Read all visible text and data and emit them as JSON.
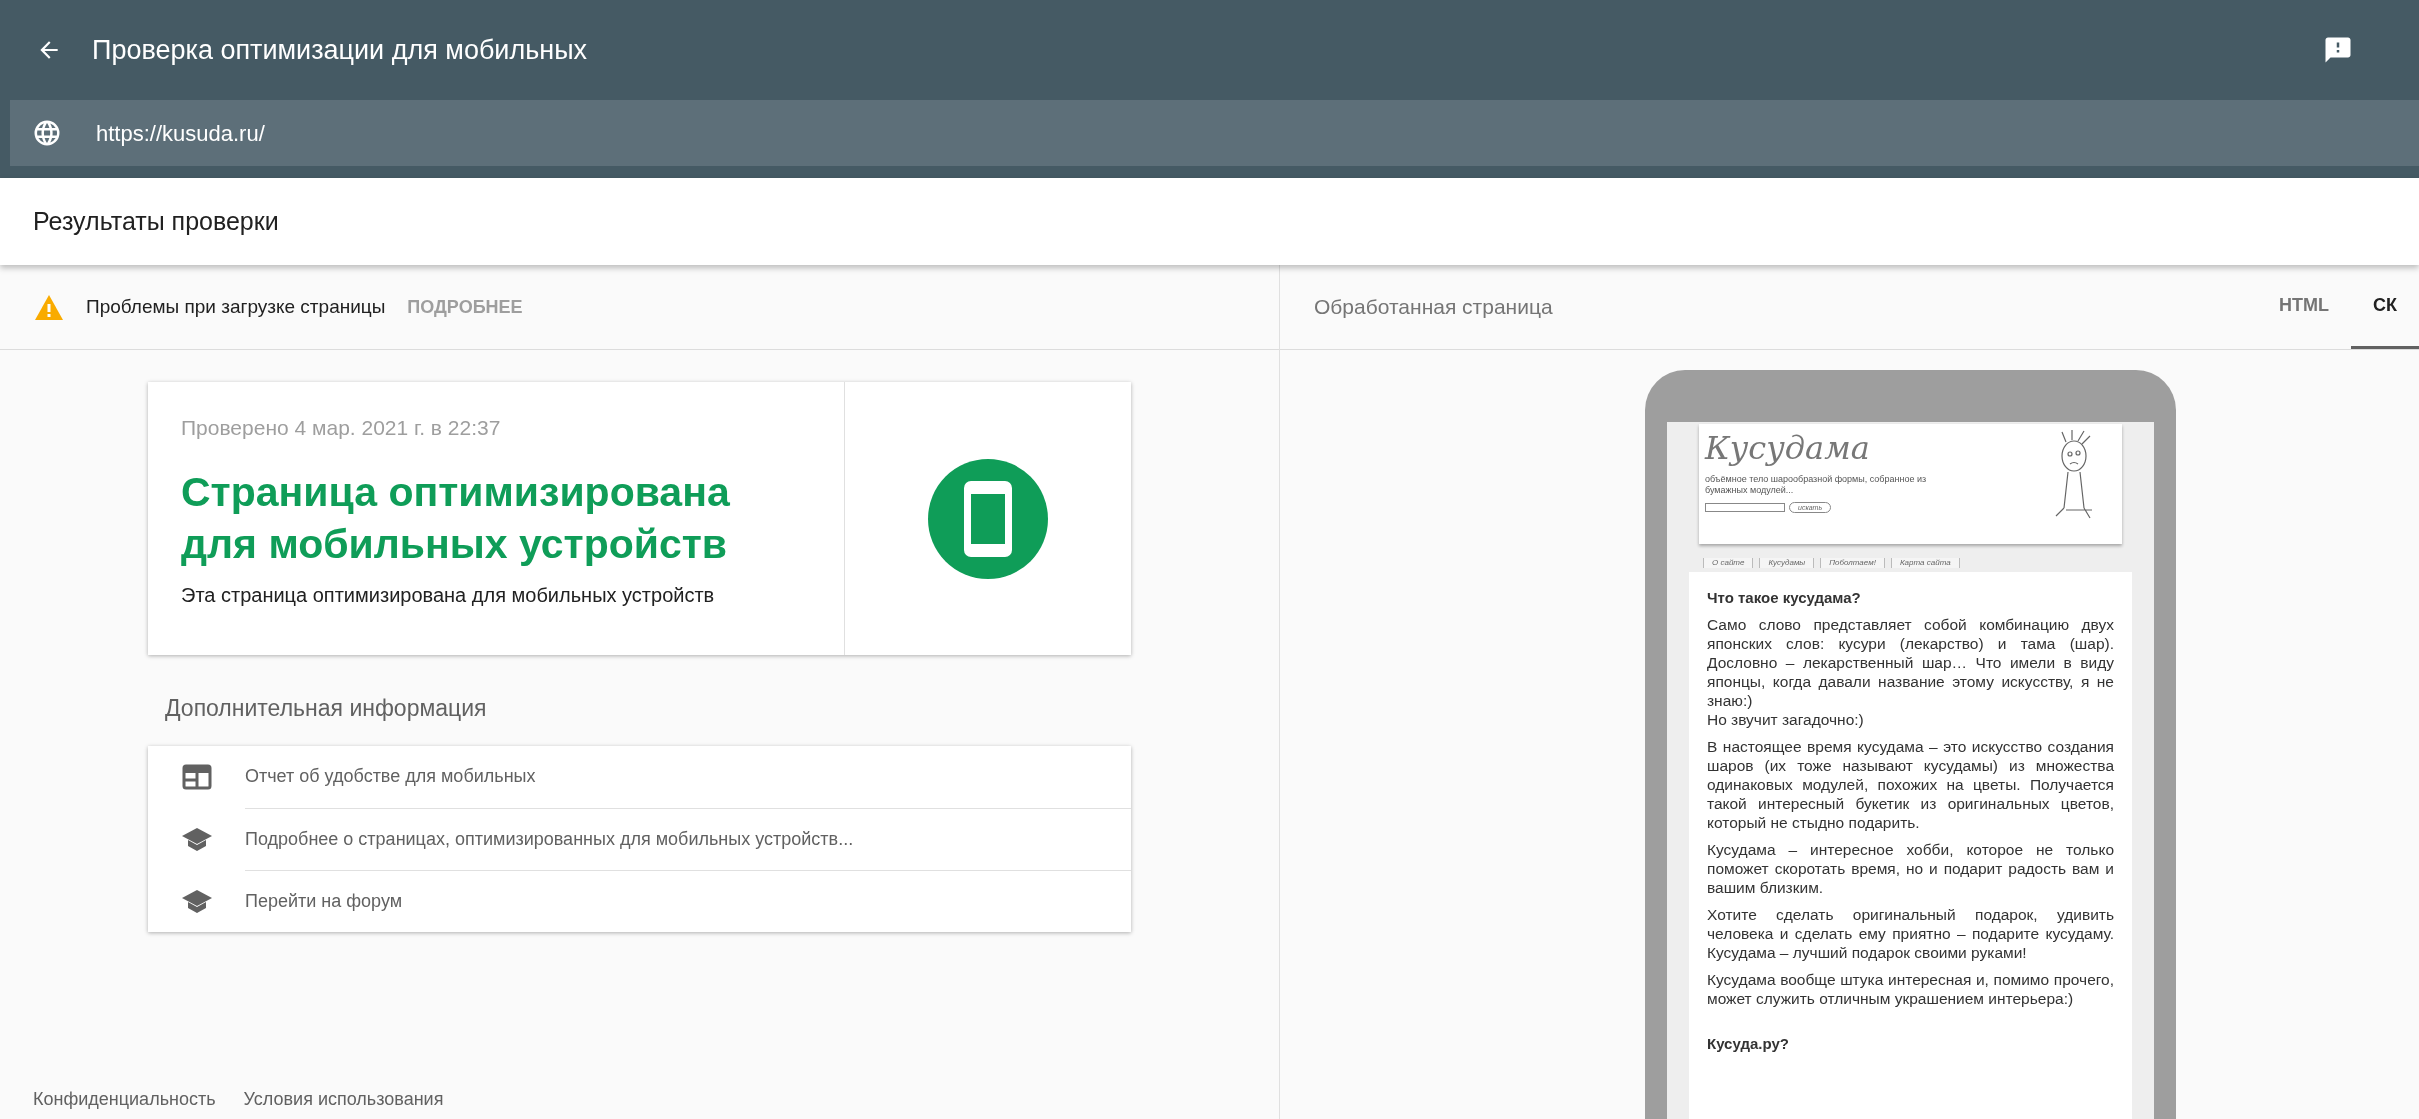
{
  "app_bar": {
    "title": "Проверка оптимизации для мобильных",
    "url": "https://kusuda.ru/"
  },
  "results_header": "Результаты проверки",
  "warning": {
    "text": "Проблемы при загрузке страницы",
    "link": "ПОДРОБНЕЕ"
  },
  "result_card": {
    "checked_at": "Проверено 4 мар. 2021 г. в 22:37",
    "title": "Страница оптимизирована для мобильных устройств",
    "subtitle": "Эта страница оптимизирована для мобильных устройств"
  },
  "additional_info": {
    "heading": "Дополнительная информация",
    "items": [
      {
        "kind": "report",
        "text": "Отчет об удобстве для мобильных"
      },
      {
        "kind": "learn",
        "text": "Подробнее о страницах, оптимизированных для мобильных устройств..."
      },
      {
        "kind": "learn",
        "text": "Перейти на форум"
      }
    ]
  },
  "footer": [
    "Конфиденциальность",
    "Условия использования"
  ],
  "preview_panel": {
    "label": "Обработанная страница",
    "tabs": [
      {
        "label": "HTML",
        "selected": false
      },
      {
        "label": "СК",
        "selected": true
      }
    ]
  },
  "rendered_site": {
    "logo": "Кусудама",
    "tagline": "объёмное тело шарообразной формы, собранное из бумажных модулей...",
    "search_button": "искать",
    "nav": [
      "О сайте",
      "Кусудамы",
      "Поболтаем!",
      "Карта сайта"
    ],
    "heading": "Что такое кусудама?",
    "paragraphs": [
      "Само слово представляет собой комбинацию двух японских слов: кусури (лекарство) и тама (шар). Дословно – лекарственный шар… Что имели в виду японцы, когда давали название этому искусству, я не знаю:)",
      "Но звучит загадочно:)",
      "В настоящее время кусудама – это искусство создания шаров (их тоже называют кусудамы) из множества одинаковых модулей, похожих на цветы. Получается такой интересный букетик из оригинальных цветов, который не стыдно подарить.",
      "Кусудама – интересное хобби, которое не только поможет скоротать время, но и подарит радость вам и вашим близким.",
      "Хотите сделать оригинальный подарок, удивить человека и сделать ему приятно – подарите кусудаму. Кусудама – лучший подарок своими руками!",
      "Кусудама вообще штука интересная и, помимо прочего, может служить отличным украшением интерьера:)"
    ],
    "heading_2": "Кусуда.ру?"
  }
}
